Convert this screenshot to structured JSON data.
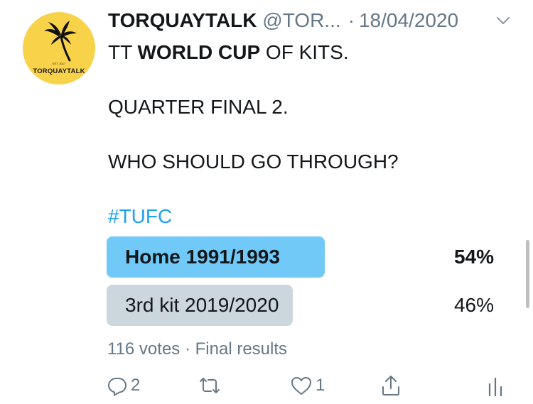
{
  "tweet": {
    "author_avatar_text": "TORQUAYTALK",
    "author_avatar_est": "EST. 2017",
    "author_name": "TORQUAYTALK",
    "author_handle": "@TOR...",
    "separator": "·",
    "date": "18/04/2020",
    "text": {
      "line1_prefix": "TT ",
      "line1_bold": "WORLD CUP",
      "line1_suffix": " OF KITS.",
      "line2": "QUARTER FINAL 2.",
      "line3": "WHO SHOULD GO THROUGH?",
      "hashtag": "#TUFC"
    }
  },
  "poll": {
    "options": [
      {
        "label": "Home 1991/1993",
        "percent_text": "54%",
        "percent": 54,
        "winner": true
      },
      {
        "label": "3rd kit 2019/2020",
        "percent_text": "46%",
        "percent": 46,
        "winner": false
      }
    ],
    "votes": "116 votes",
    "meta_separator": "·",
    "status": "Final results"
  },
  "actions": {
    "reply_count": "2",
    "retweet_count": "",
    "like_count": "1"
  },
  "colors": {
    "accent": "#1da1f2",
    "poll_winner": "#71c9f8",
    "poll_loser": "#ccd6dd",
    "secondary_text": "#657786",
    "avatar_bg": "#f8d34a"
  },
  "icons": [
    "chevron-down-icon",
    "reply-icon",
    "retweet-icon",
    "like-icon",
    "share-icon",
    "analytics-icon"
  ]
}
